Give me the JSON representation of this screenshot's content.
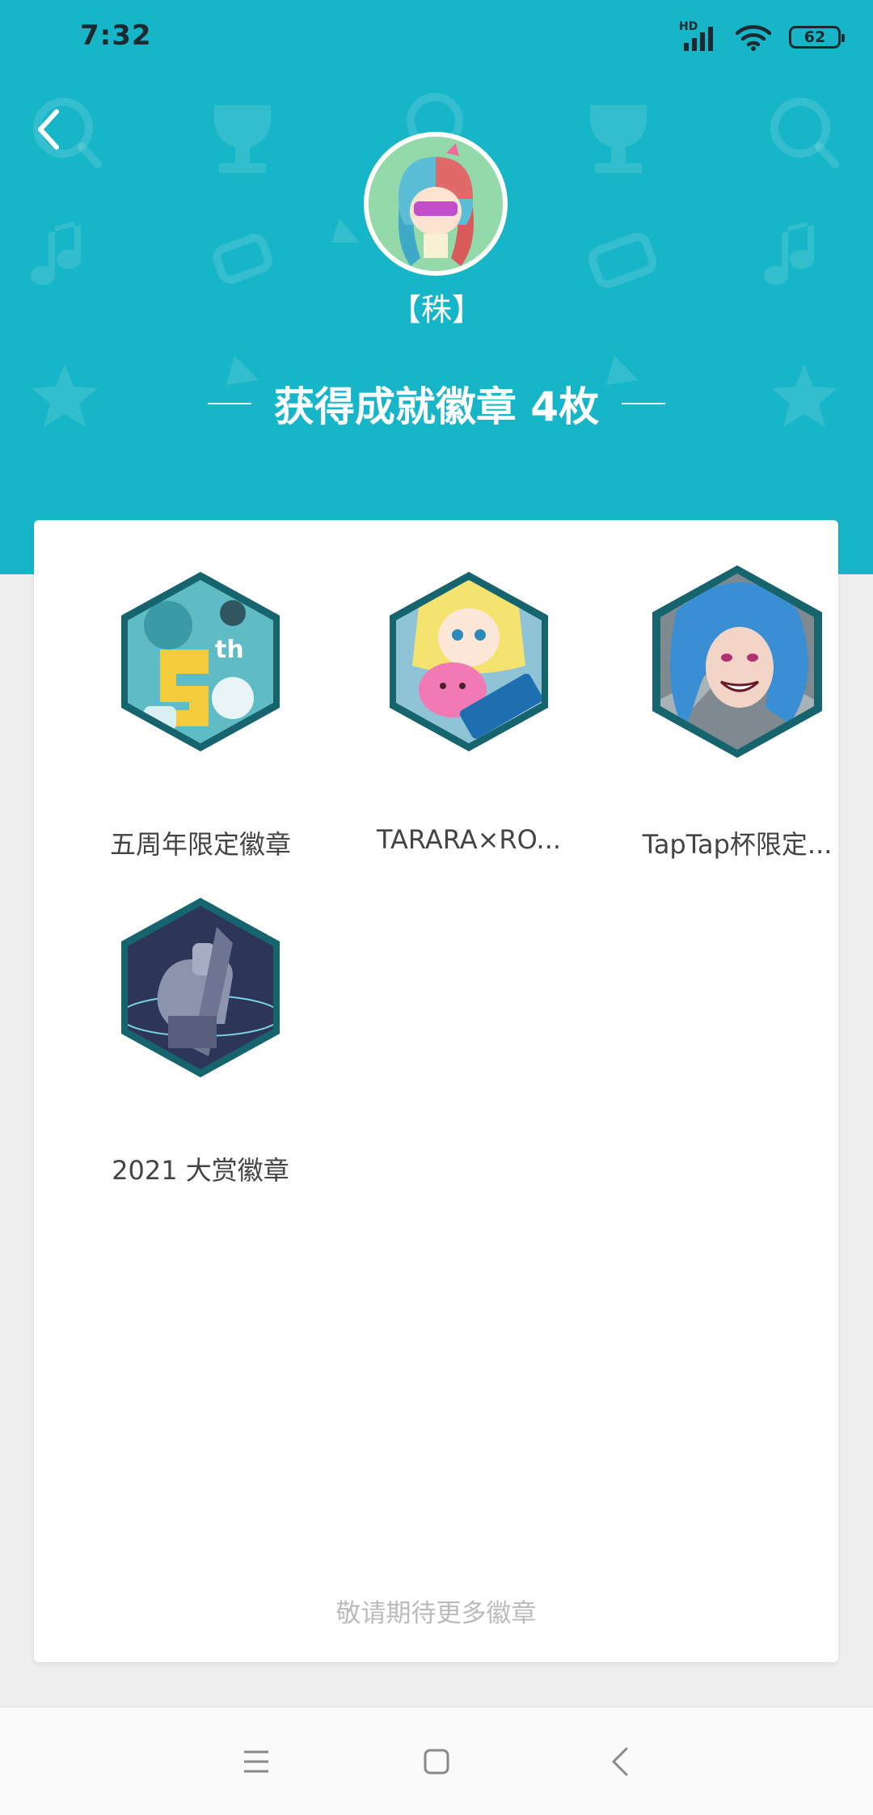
{
  "status_bar": {
    "time": "7:32",
    "network_label": "HD",
    "battery": "62",
    "icons": [
      "signal-icon",
      "wifi-icon",
      "battery-icon"
    ]
  },
  "header": {
    "background_color": "#17b5c8",
    "back_icon": "chevron-left-icon",
    "username": "【秼】",
    "achievement_count_text": "获得成就徽章 4枚"
  },
  "badges": [
    {
      "name": "五周年限定徽章"
    },
    {
      "name": "TARARA×RO..."
    },
    {
      "name": "TapTap杯限定..."
    },
    {
      "name": "2021 大赏徽章"
    }
  ],
  "footer_note": "敬请期待更多徽章",
  "nav_bar": {
    "icons": [
      "menu-icon",
      "home-icon",
      "back-icon"
    ]
  }
}
